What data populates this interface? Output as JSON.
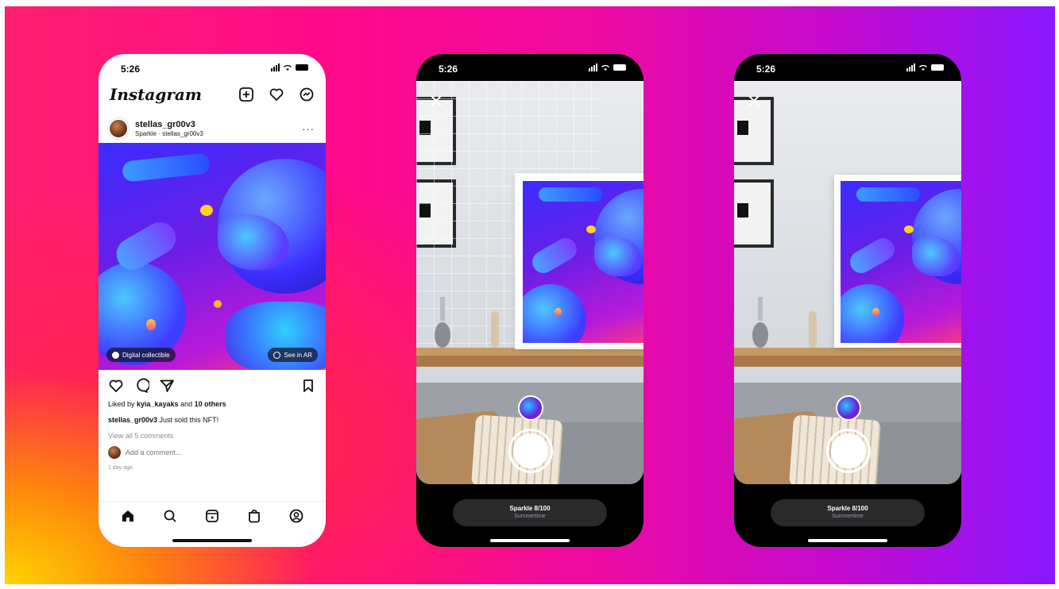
{
  "status": {
    "time": "5:26"
  },
  "feed": {
    "logo": "Instagram",
    "post": {
      "username": "stellas_gr00v3",
      "subtitle": "Sparkle · stellas_gr00v3",
      "badge_left": "Digital collectible",
      "badge_right": "See in AR",
      "likes_prefix": "Liked by ",
      "likes_user": "kyia_kayaks",
      "likes_mid": " and ",
      "likes_count": "10 others",
      "caption_user": "stellas_gr00v3",
      "caption_text": " Just sold this NFT!",
      "view_comments": "View all 5 comments",
      "add_comment_placeholder": "Add a comment...",
      "time_ago": "1 day ago"
    },
    "tabs": [
      "home-icon",
      "search-icon",
      "reels-icon",
      "shop-icon",
      "profile-icon"
    ]
  },
  "ar_view": {
    "title": "Sparkle 8/100",
    "subtitle": "Summertime"
  },
  "colors": {
    "art_primary": "#3b2cff",
    "art_accent": "#2ac6ff",
    "instagram_text": "#111111"
  }
}
